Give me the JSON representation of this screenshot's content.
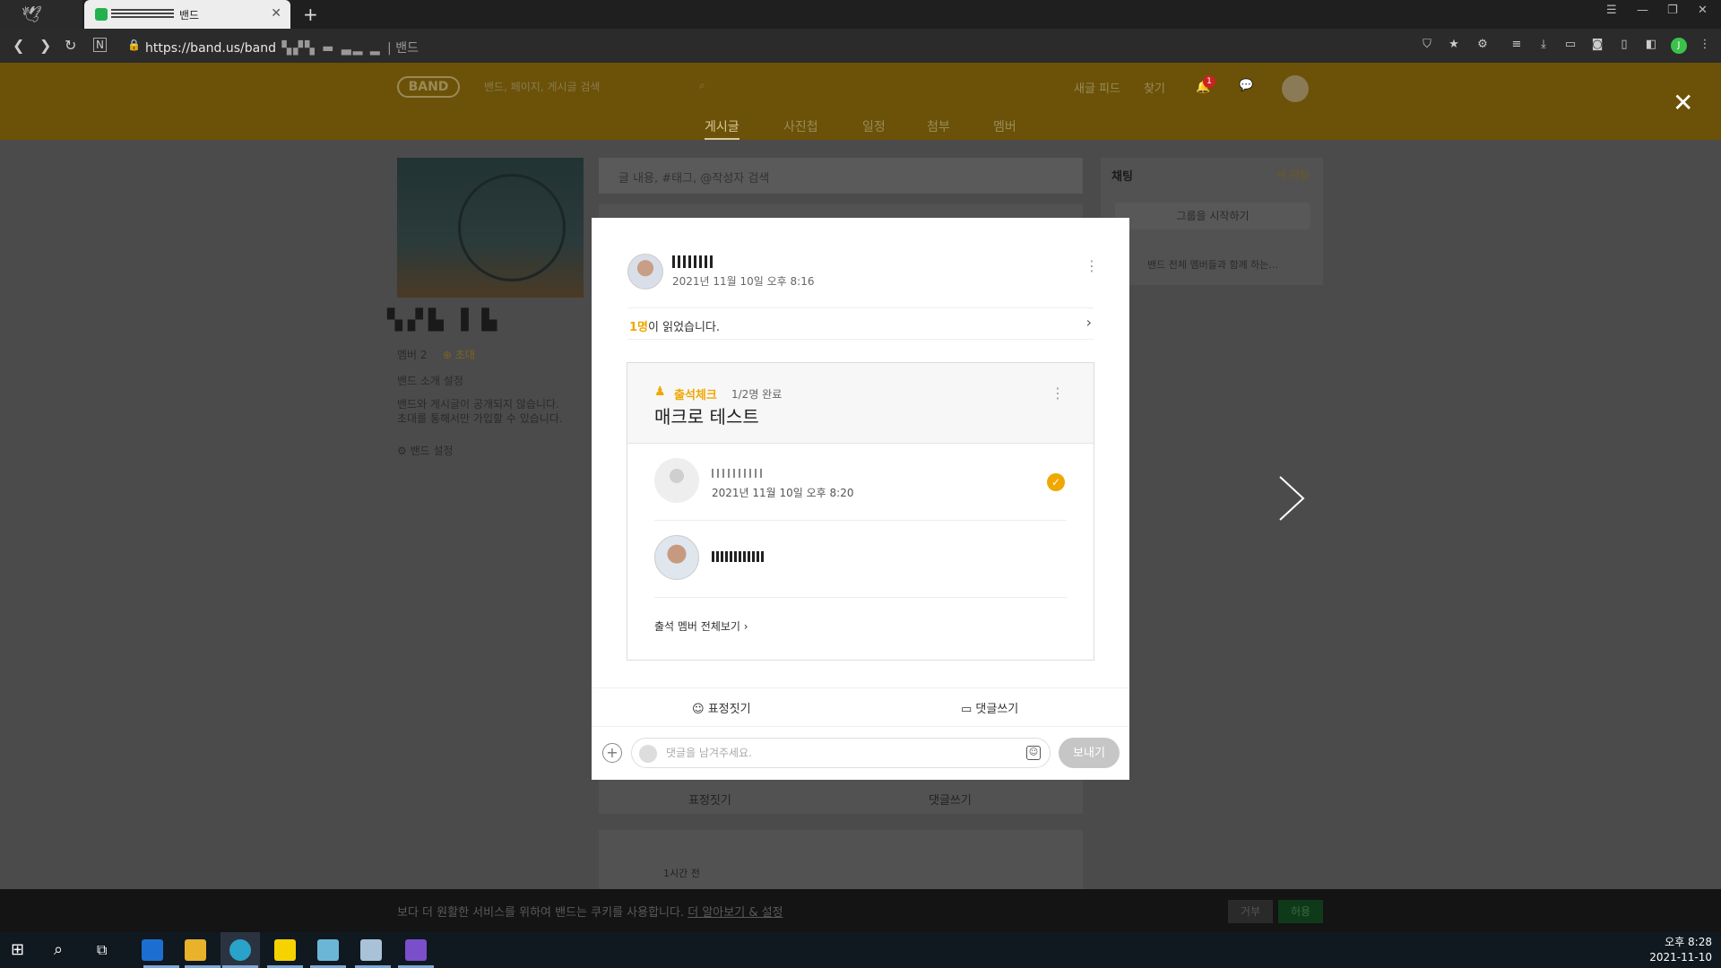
{
  "browser": {
    "tab_title": "밴드",
    "url_main": "https://band.us/band",
    "url_suffix": "| 밴드",
    "profile_initial": "J"
  },
  "band_header": {
    "logo": "BAND",
    "search_placeholder": "밴드, 페이지, 게시글 검색",
    "links": [
      "새글 피드",
      "찾기"
    ],
    "notification_count": "1",
    "tabs": [
      "게시글",
      "사진첩",
      "일정",
      "첨부",
      "멤버"
    ]
  },
  "left_panel": {
    "members": "멤버 2",
    "invite": "초대",
    "intro_setting": "밴드 소개 설정",
    "privacy_line1": "밴드와 게시글이 공개되지 않습니다.",
    "privacy_line2": "초대를 통해서만 가입할 수 있습니다.",
    "band_settings": "밴드 설정"
  },
  "feed": {
    "search_placeholder": "글 내용, #태그, @작성자 검색",
    "below_actions": [
      "표정짓기",
      "댓글쓰기"
    ],
    "second_post_time": "1시간 전"
  },
  "chat": {
    "title": "채팅",
    "new_chat": "새 채팅",
    "start_group": "그룹을 시작하기",
    "chat_preview": "밴드 전체 멤버들과 함께 하는..."
  },
  "cookie": {
    "text": "보다 더 원활한 서비스를 위하여 밴드는 쿠키를 사용합니다.",
    "link": "더 알아보기 & 설정",
    "deny": "거부",
    "allow": "허용"
  },
  "modal": {
    "post_date": "2021년 11월 10일 오후 8:16",
    "read_count": "1명",
    "read_suffix": "이 읽었습니다.",
    "attendance": {
      "label": "출석체크",
      "progress": "1/2명 완료",
      "title": "매크로 테스트",
      "members": [
        {
          "date": "2021년 11월 10일 오후 8:20",
          "checked": true
        },
        {
          "date": "",
          "checked": false
        }
      ],
      "view_all": "출석 멤버 전체보기"
    },
    "actions": {
      "emotion": "표정짓기",
      "comment": "댓글쓰기"
    },
    "comment_placeholder": "댓글을 남겨주세요.",
    "send": "보내기"
  },
  "taskbar": {
    "time": "오후 8:28",
    "date": "2021-11-10"
  }
}
